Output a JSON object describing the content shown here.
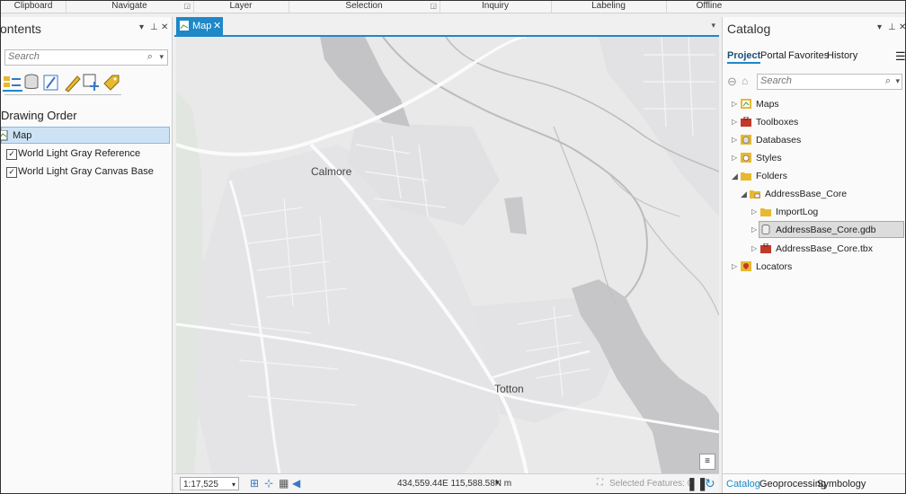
{
  "ribbon": {
    "groups": [
      "Clipboard",
      "Navigate",
      "Layer",
      "Selection",
      "Inquiry",
      "Labeling",
      "Offline"
    ]
  },
  "contents": {
    "title": "ontents",
    "search_placeholder": "Search",
    "section_title": "Drawing Order",
    "layers": [
      {
        "label": "Map",
        "selected": true
      },
      {
        "label": "World Light Gray Reference",
        "checked": true
      },
      {
        "label": "World Light Gray Canvas Base",
        "checked": true
      }
    ]
  },
  "map": {
    "tab_label": "Map",
    "place_labels": [
      "Calmore",
      "Totton"
    ],
    "scale": "1:17,525",
    "coordinates": "434,559.44E 115,588.58N m",
    "selected_features": "Selected Features: 0"
  },
  "catalog": {
    "title": "Catalog",
    "tabs": [
      "Project",
      "Portal",
      "Favorites",
      "History"
    ],
    "active_tab": "Project",
    "search_placeholder": "Search",
    "tree": [
      {
        "label": "Maps",
        "icon": "maps-icon"
      },
      {
        "label": "Toolboxes",
        "icon": "toolbox-icon"
      },
      {
        "label": "Databases",
        "icon": "database-icon"
      },
      {
        "label": "Styles",
        "icon": "styles-icon"
      },
      {
        "label": "Folders",
        "icon": "folder-icon"
      },
      {
        "label": "AddressBase_Core",
        "icon": "folder-connection-icon"
      },
      {
        "label": "ImportLog",
        "icon": "folder-icon"
      },
      {
        "label": "AddressBase_Core.gdb",
        "icon": "geodatabase-icon",
        "selected": true
      },
      {
        "label": "AddressBase_Core.tbx",
        "icon": "toolbox-icon"
      },
      {
        "label": "Locators",
        "icon": "locator-icon"
      }
    ],
    "bottom_tabs": [
      "Catalog",
      "Geoprocessing",
      "Symbology"
    ],
    "active_bottom_tab": "Catalog"
  },
  "colors": {
    "accent": "#1e88c9",
    "map_background": "#e9e9ea",
    "water": "#c4c4c6"
  }
}
